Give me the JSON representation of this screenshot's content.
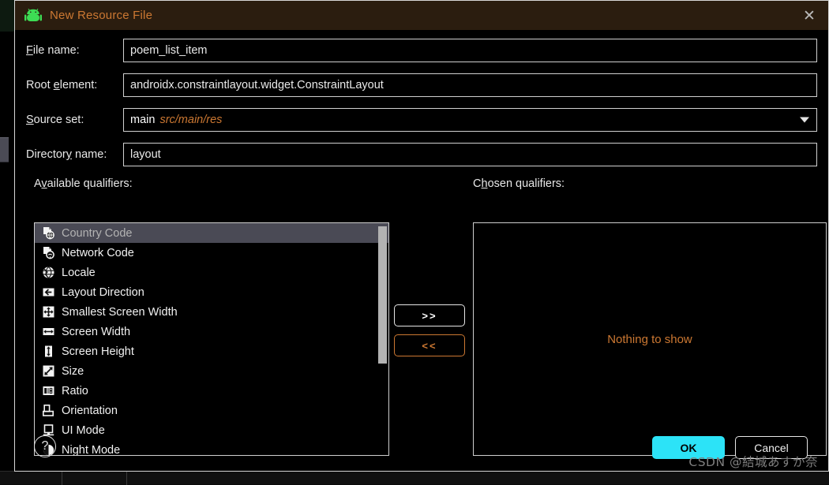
{
  "window": {
    "title": "New Resource File",
    "app_icon": "android-robot-icon",
    "close_icon": "close-icon",
    "title_bar_color": "#2b1d0f",
    "accent_color": "#cc7832"
  },
  "form": {
    "fields": [
      {
        "label_pre": "",
        "label_mnemonic": "F",
        "label_post": "ile name:",
        "value": "poem_list_item",
        "type": "text"
      },
      {
        "label_pre": "Root ",
        "label_mnemonic": "e",
        "label_post": "lement:",
        "value": "androidx.constraintlayout.widget.ConstraintLayout",
        "type": "text"
      },
      {
        "label_pre": "",
        "label_mnemonic": "S",
        "label_post": "ource set:",
        "value_main": "main",
        "value_path": "src/main/res",
        "type": "combo",
        "arrow_icon": "chevron-down-icon"
      },
      {
        "label_pre": "Director",
        "label_mnemonic": "y",
        "label_post": " name:",
        "value": "layout",
        "type": "text"
      }
    ]
  },
  "qualifiers": {
    "available_label_pre": "A",
    "available_label_mnemonic": "v",
    "available_label_post": "ailable qualifiers:",
    "chosen_label_pre": "C",
    "chosen_label_mnemonic": "h",
    "chosen_label_post": "osen qualifiers:",
    "available_items": [
      {
        "label": "Country Code",
        "icon": "country-code-icon",
        "selected": true
      },
      {
        "label": "Network Code",
        "icon": "network-code-icon",
        "selected": false
      },
      {
        "label": "Locale",
        "icon": "globe-icon",
        "selected": false
      },
      {
        "label": "Layout Direction",
        "icon": "arrow-left-icon",
        "selected": false
      },
      {
        "label": "Smallest Screen Width",
        "icon": "four-way-arrow-icon",
        "selected": false
      },
      {
        "label": "Screen Width",
        "icon": "arrow-horizontal-icon",
        "selected": false
      },
      {
        "label": "Screen Height",
        "icon": "arrow-vertical-icon",
        "selected": false
      },
      {
        "label": "Size",
        "icon": "arrow-diagonal-icon",
        "selected": false
      },
      {
        "label": "Ratio",
        "icon": "ratio-icon",
        "selected": false
      },
      {
        "label": "Orientation",
        "icon": "orientation-icon",
        "selected": false
      },
      {
        "label": "UI Mode",
        "icon": "ui-mode-icon",
        "selected": false
      },
      {
        "label": "Night Mode",
        "icon": "night-mode-icon",
        "selected": false
      }
    ],
    "add_button_label": ">>",
    "remove_button_label": "<<",
    "chosen_empty_text": "Nothing to show"
  },
  "footer": {
    "help_label": "?",
    "ok_label": "OK",
    "cancel_label": "Cancel",
    "ok_color": "#2ce3f7"
  },
  "watermark": "CSDN @結城あすか奈"
}
